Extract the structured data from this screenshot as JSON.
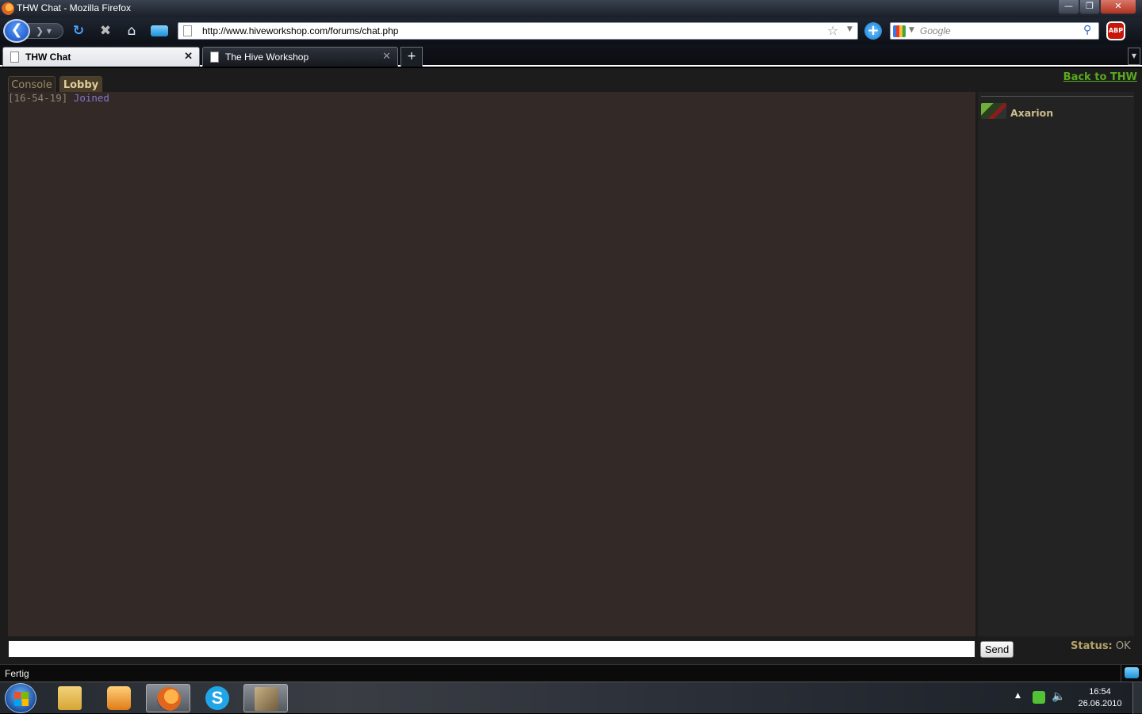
{
  "window": {
    "title": "THW Chat - Mozilla Firefox",
    "min_glyph": "—",
    "max_glyph": "❐",
    "close_glyph": "✕"
  },
  "navbar": {
    "back_glyph": "❮",
    "forward_glyph": "❯ ▾",
    "reload_glyph": "↻",
    "stop_glyph": "✖",
    "home_glyph": "⌂",
    "url": "http://www.hiveworkshop.com/forums/chat.php",
    "bookmark_glyph": "☆",
    "dropdown_glyph": "▼",
    "addon_glyph": "+",
    "search_placeholder": "Google",
    "search_glyph": "⚲",
    "abp_label": "ABP"
  },
  "tabs": [
    {
      "label": "THW Chat",
      "close": "✕",
      "active": true
    },
    {
      "label": "The Hive Workshop",
      "close": "✕",
      "active": false
    }
  ],
  "newtab_glyph": "+",
  "tablist_glyph": "▼",
  "chat": {
    "tabs": [
      "Console",
      "Lobby"
    ],
    "back_link": "Back to THW",
    "messages": [
      {
        "time": "[16-54-19]",
        "text": "Joined"
      }
    ],
    "users": [
      {
        "name": "Axarion",
        "icon": "user-avatar-icon"
      }
    ],
    "input_value": "",
    "send_label": "Send",
    "status_label": "Status:",
    "status_value": "OK"
  },
  "statusbar": {
    "text": "Fertig"
  },
  "taskbar": {
    "apps": [
      "explorer-icon",
      "media-player-icon",
      "firefox-icon",
      "skype-icon",
      "warcraft-editor-icon"
    ],
    "skype_glyph": "S",
    "tray_arrow": "▲",
    "volume_glyph": "🔈",
    "time": "16:54",
    "date": "26.06.2010"
  },
  "colors": {
    "link": "#59a81f",
    "timestamp": "#8f8577",
    "system_message": "#8276c9",
    "username": "#cbbd8a",
    "chat_background": "#332a28"
  }
}
